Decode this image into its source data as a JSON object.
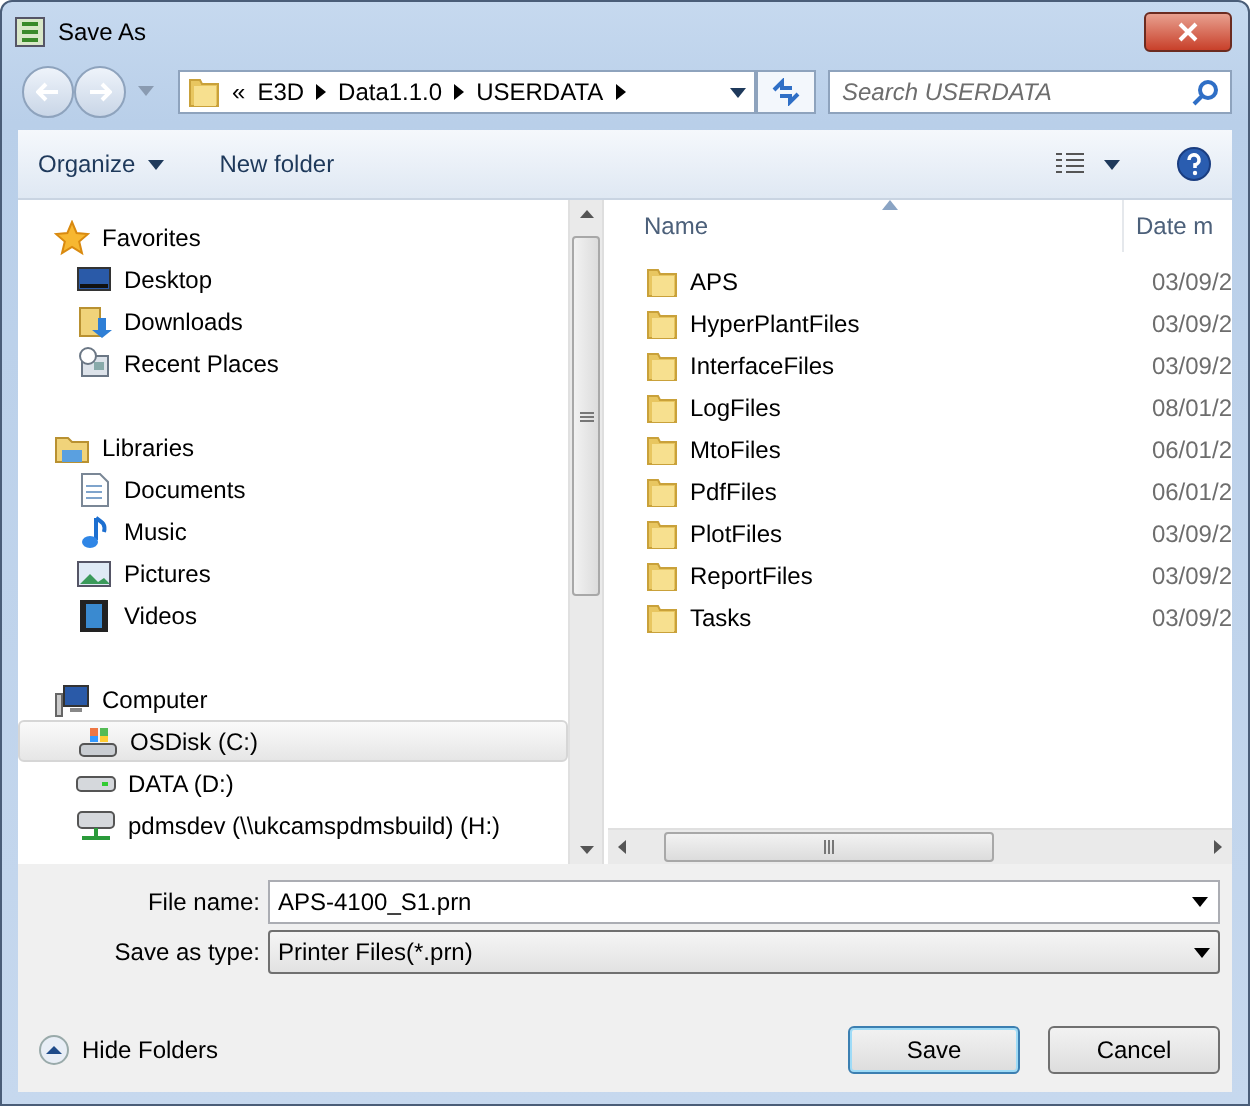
{
  "window": {
    "title": "Save As"
  },
  "address": {
    "overflow": "«",
    "crumbs": [
      "E3D",
      "Data1.1.0",
      "USERDATA"
    ]
  },
  "search": {
    "placeholder": "Search USERDATA"
  },
  "toolbar": {
    "organize": "Organize",
    "new_folder": "New folder"
  },
  "navigation": [
    {
      "label": "Favorites",
      "kind": "star",
      "children": [
        {
          "label": "Desktop",
          "kind": "desktop",
          "selected": false
        },
        {
          "label": "Downloads",
          "kind": "downloads",
          "selected": false
        },
        {
          "label": "Recent Places",
          "kind": "recent",
          "selected": false
        }
      ]
    },
    {
      "label": "Libraries",
      "kind": "library",
      "children": [
        {
          "label": "Documents",
          "kind": "document",
          "selected": false
        },
        {
          "label": "Music",
          "kind": "music",
          "selected": false
        },
        {
          "label": "Pictures",
          "kind": "picture",
          "selected": false
        },
        {
          "label": "Videos",
          "kind": "video",
          "selected": false
        }
      ]
    },
    {
      "label": "Computer",
      "kind": "computer",
      "children": [
        {
          "label": "OSDisk (C:)",
          "kind": "system-disk",
          "selected": true
        },
        {
          "label": "DATA (D:)",
          "kind": "disk",
          "selected": false
        },
        {
          "label": "pdmsdev (\\\\ukcamspdmsbuild) (H:)",
          "kind": "network",
          "selected": false
        }
      ]
    }
  ],
  "files": {
    "columns": [
      "Name",
      "Date m"
    ],
    "rows": [
      {
        "name": "APS",
        "date": "03/09/2"
      },
      {
        "name": "HyperPlantFiles",
        "date": "03/09/2"
      },
      {
        "name": "InterfaceFiles",
        "date": "03/09/2"
      },
      {
        "name": "LogFiles",
        "date": "08/01/2"
      },
      {
        "name": "MtoFiles",
        "date": "06/01/2"
      },
      {
        "name": "PdfFiles",
        "date": "06/01/2"
      },
      {
        "name": "PlotFiles",
        "date": "03/09/2"
      },
      {
        "name": "ReportFiles",
        "date": "03/09/2"
      },
      {
        "name": "Tasks",
        "date": "03/09/2"
      }
    ]
  },
  "form": {
    "file_name": {
      "label": "File name:",
      "value": "APS-4100_S1.prn"
    },
    "save_type": {
      "label": "Save as type:",
      "value": "Printer Files(*.prn)"
    }
  },
  "hide_folders": "Hide Folders",
  "buttons": [
    {
      "label": "Save",
      "default": true
    },
    {
      "label": "Cancel",
      "default": false
    }
  ]
}
